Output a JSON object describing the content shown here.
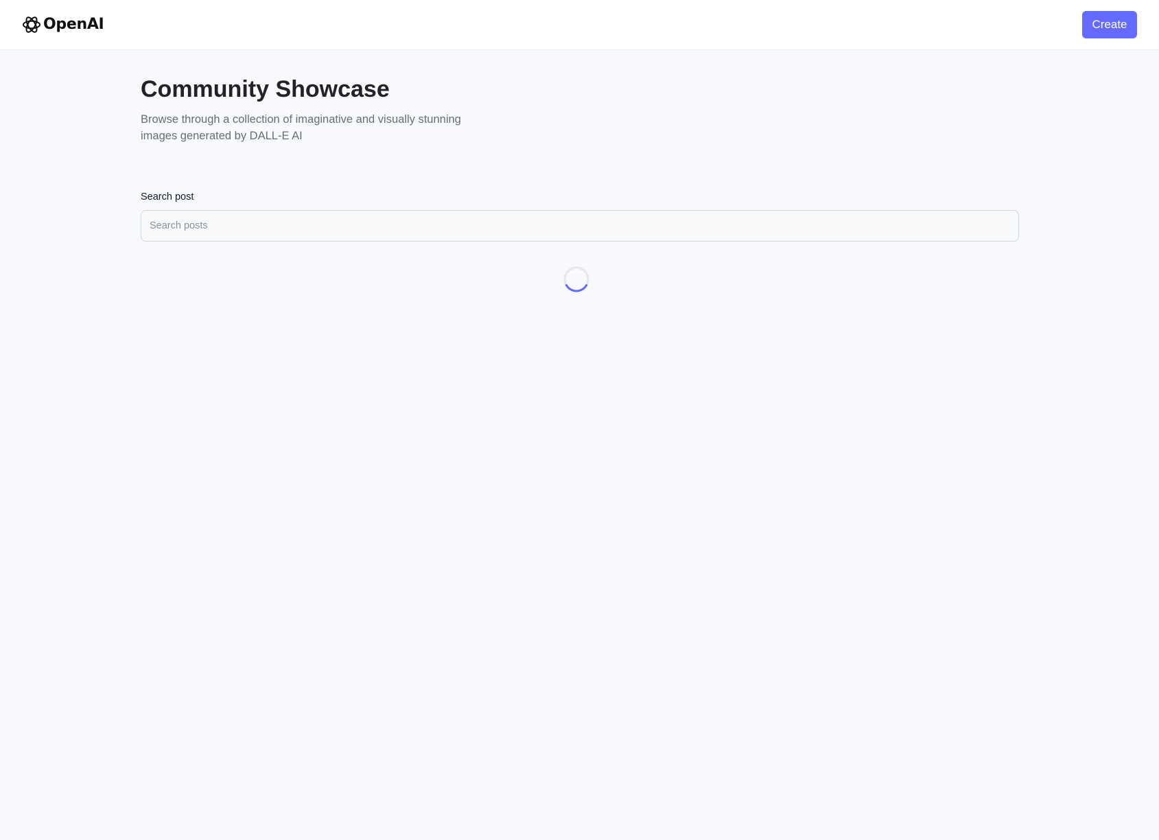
{
  "header": {
    "logo_text": "OpenAI",
    "logo_icon": "openai-logo-icon",
    "create_label": "Create"
  },
  "main": {
    "title": "Community Showcase",
    "subtitle": "Browse through a collection of imaginative and visually stunning images generated by DALL-E AI",
    "search": {
      "label": "Search post",
      "placeholder": "Search posts",
      "value": ""
    },
    "loader_icon": "spinner-icon"
  },
  "colors": {
    "accent": "#6469ff",
    "background": "#f8f9fc",
    "header_background": "#ffffff",
    "title": "#222328",
    "subtitle": "#666e75",
    "input_border": "#d1d5db",
    "spinner_track": "#e5e7eb"
  }
}
